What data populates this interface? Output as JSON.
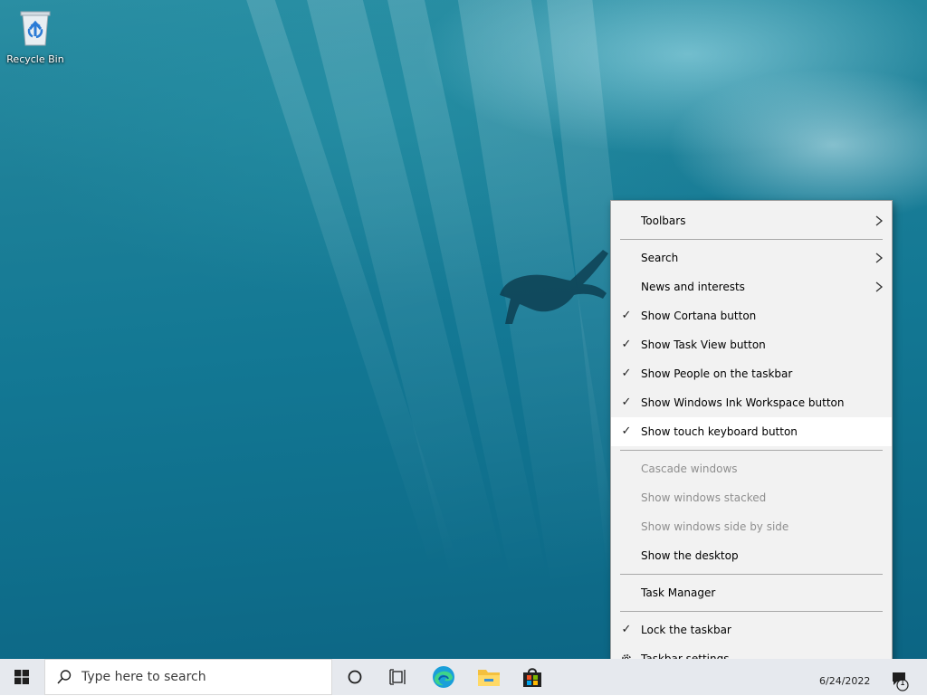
{
  "desktop": {
    "recycle_bin_label": "Recycle Bin"
  },
  "context_menu": {
    "items": [
      {
        "label": "Toolbars",
        "submenu": true,
        "checked": false,
        "enabled": true
      },
      {
        "label": "Search",
        "submenu": true,
        "checked": false,
        "enabled": true
      },
      {
        "label": "News and interests",
        "submenu": true,
        "checked": false,
        "enabled": true
      },
      {
        "label": "Show Cortana button",
        "submenu": false,
        "checked": true,
        "enabled": true
      },
      {
        "label": "Show Task View button",
        "submenu": false,
        "checked": true,
        "enabled": true
      },
      {
        "label": "Show People on the taskbar",
        "submenu": false,
        "checked": true,
        "enabled": true
      },
      {
        "label": "Show Windows Ink Workspace button",
        "submenu": false,
        "checked": true,
        "enabled": true
      },
      {
        "label": "Show touch keyboard button",
        "submenu": false,
        "checked": true,
        "enabled": true,
        "highlighted": true
      },
      {
        "label": "Cascade windows",
        "submenu": false,
        "checked": false,
        "enabled": false
      },
      {
        "label": "Show windows stacked",
        "submenu": false,
        "checked": false,
        "enabled": false
      },
      {
        "label": "Show windows side by side",
        "submenu": false,
        "checked": false,
        "enabled": false
      },
      {
        "label": "Show the desktop",
        "submenu": false,
        "checked": false,
        "enabled": true
      },
      {
        "label": "Task Manager",
        "submenu": false,
        "checked": false,
        "enabled": true
      },
      {
        "label": "Lock the taskbar",
        "submenu": false,
        "checked": true,
        "enabled": true
      },
      {
        "label": "Taskbar settings",
        "submenu": false,
        "checked": false,
        "enabled": true,
        "icon": "gear-icon"
      }
    ]
  },
  "taskbar": {
    "search_placeholder": "Type here to search",
    "date": "6/24/2022",
    "notification_count": "1",
    "pinned_apps": [
      "start-icon",
      "cortana-icon",
      "task-view-icon",
      "edge-icon",
      "file-explorer-icon",
      "store-icon"
    ]
  },
  "colors": {
    "menu_bg": "#f2f2f2",
    "menu_highlight": "#ffffff",
    "disabled_text": "#8f8f8f",
    "taskbar_bg": "#e6e9ee"
  }
}
